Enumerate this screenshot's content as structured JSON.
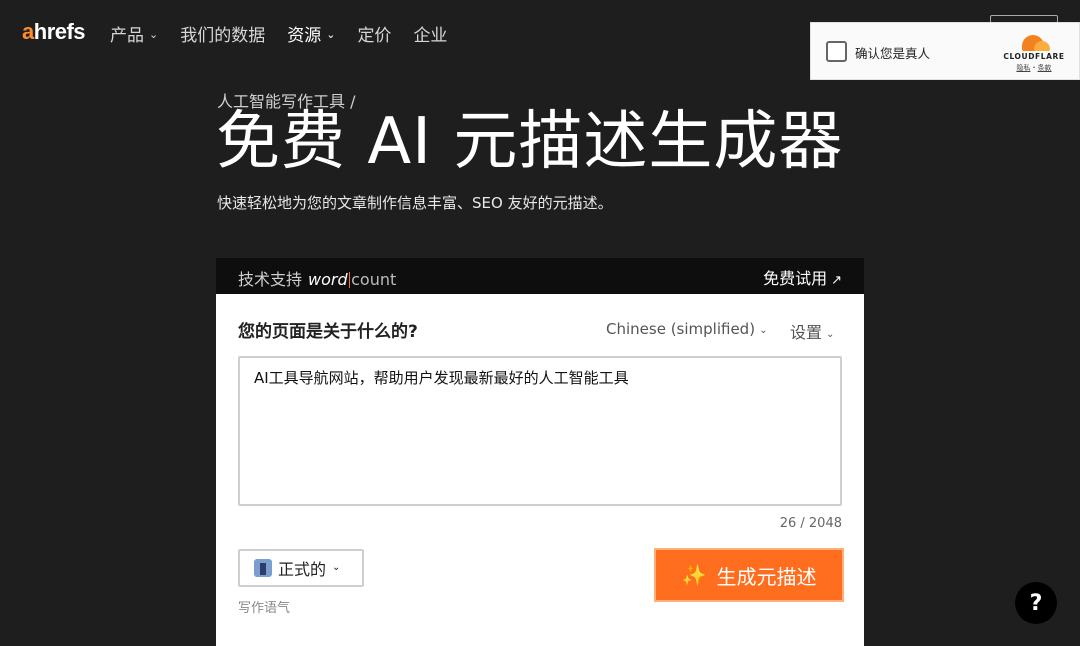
{
  "brand": {
    "logo_prefix": "a",
    "logo_rest": "hrefs",
    "accent": "#ff8c2a"
  },
  "nav": {
    "items": [
      {
        "label": "产品",
        "has_dropdown": true
      },
      {
        "label": "我们的数据",
        "has_dropdown": false
      },
      {
        "label": "资源",
        "has_dropdown": true
      },
      {
        "label": "定价",
        "has_dropdown": false
      },
      {
        "label": "企业",
        "has_dropdown": false
      }
    ]
  },
  "captcha": {
    "checkbox_label": "确认您是真人",
    "brand": "CLOUDFLARE",
    "privacy": "隐私",
    "separator": "·",
    "terms": "条款"
  },
  "hero": {
    "breadcrumb": "人工智能写作工具 /",
    "title": "免费 AI 元描述生成器",
    "subtitle": "快速轻松地为您的文章制作信息丰富、SEO 友好的元描述。"
  },
  "powered_bar": {
    "prefix": "技术支持",
    "wordcount_word": "word",
    "wordcount_count": "count",
    "cta": "免费试用",
    "cta_arrow": "↗"
  },
  "tool": {
    "question": "您的页面是关于什么的?",
    "language": "Chinese (simplified)",
    "settings": "设置",
    "input_value": "AI工具导航网站，帮助用户发现最新最好的人工智能工具",
    "counter": "26 / 2048",
    "tone": "正式的",
    "tone_caption": "写作语气",
    "generate_button": "生成元描述",
    "generate_icon": "sparkles-icon",
    "button_color": "#ff6d1f"
  },
  "help": {
    "label": "?"
  }
}
